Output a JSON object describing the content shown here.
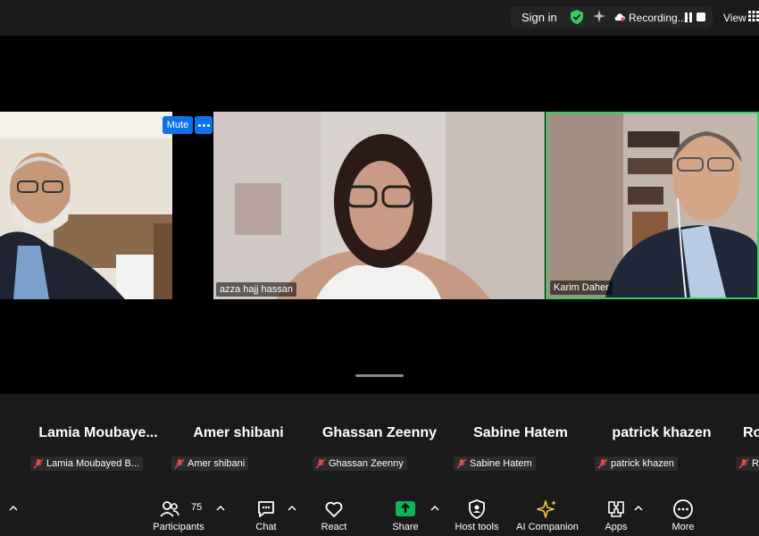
{
  "topbar": {
    "sign_in": "Sign in",
    "recording": "Recording...",
    "view": "View"
  },
  "videos": [
    {
      "name": ""
    },
    {
      "name": "azza hajj hassan"
    },
    {
      "name": "Karim Daher"
    }
  ],
  "video_controls": {
    "mute": "Mute"
  },
  "gallery": [
    {
      "display": "Lamia  Moubaye...",
      "label": "Lamia Moubayed B..."
    },
    {
      "display": "Amer shibani",
      "label": "Amer shibani"
    },
    {
      "display": "Ghassan Zeenny",
      "label": "Ghassan Zeenny"
    },
    {
      "display": "Sabine Hatem",
      "label": "Sabine Hatem"
    },
    {
      "display": "patrick khazen",
      "label": "patrick khazen"
    },
    {
      "display": "Ro",
      "label": "Ro"
    }
  ],
  "toolbar": {
    "participants": "Participants",
    "participants_count": "75",
    "chat": "Chat",
    "react": "React",
    "share": "Share",
    "host_tools": "Host tools",
    "ai_companion": "AI Companion",
    "apps": "Apps",
    "more": "More"
  },
  "colors": {
    "active_speaker_border": "#2fd05f",
    "share_green": "#0cb45a",
    "mute_blue": "#0e72ed",
    "ai_gold": "#f5c542",
    "mic_off_red": "#e5484d"
  }
}
